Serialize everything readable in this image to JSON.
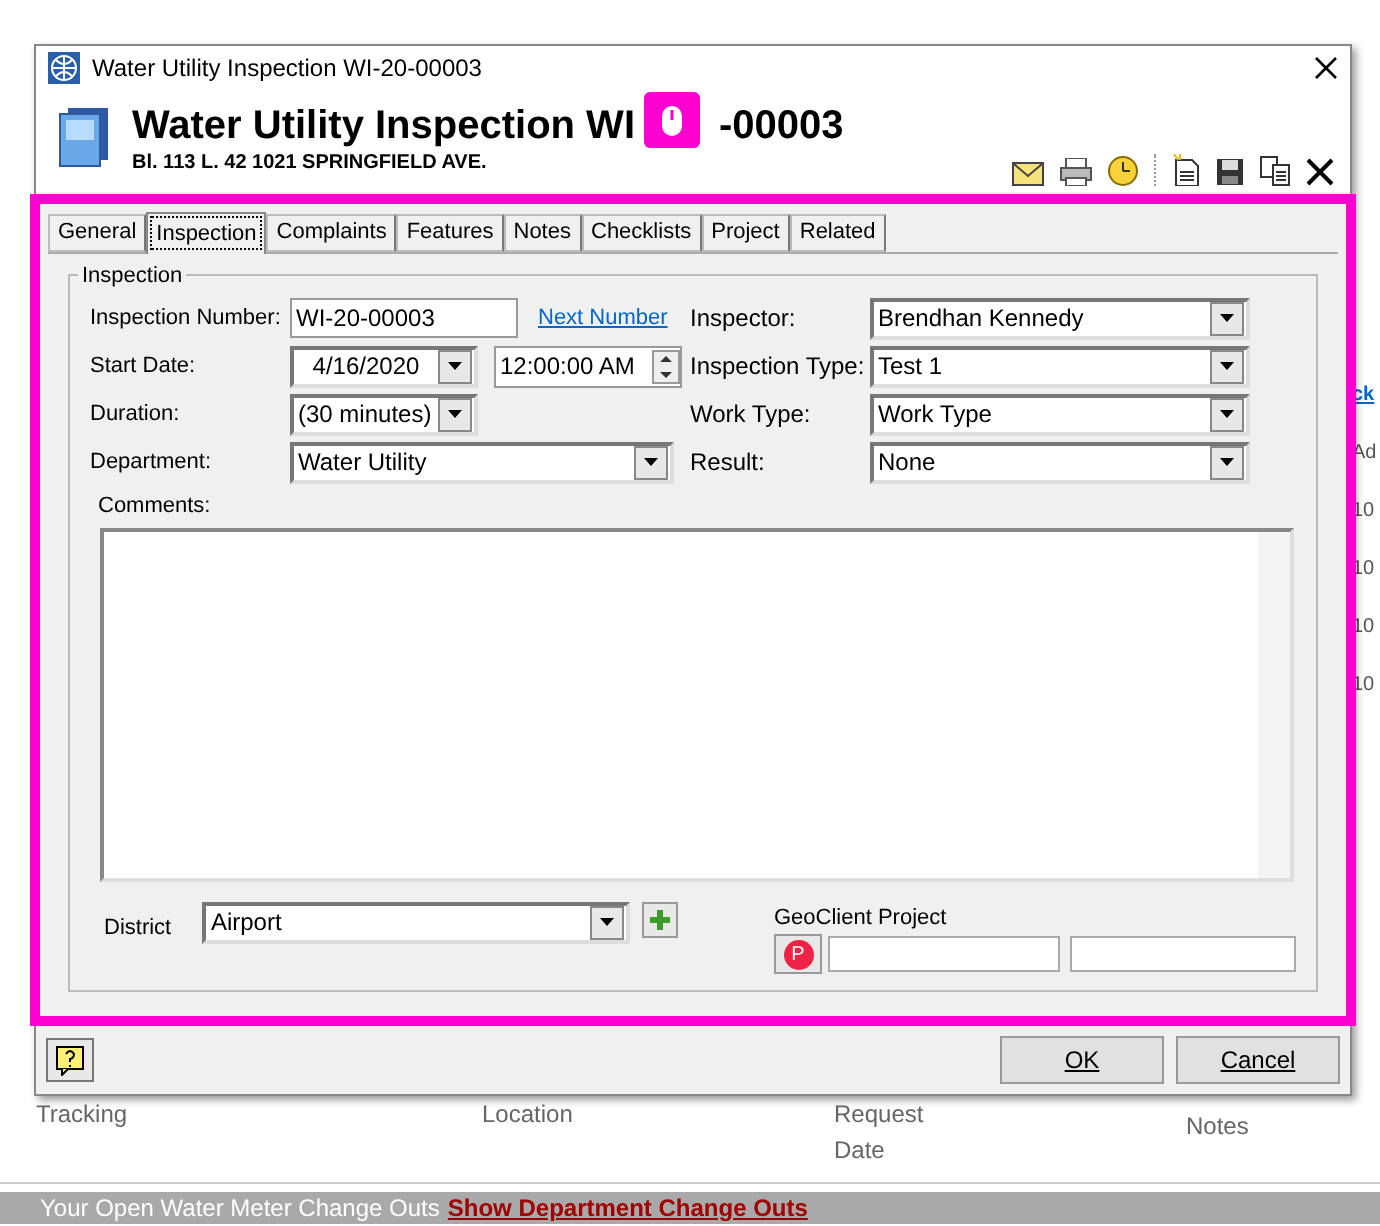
{
  "background": {
    "edge_texts": [
      {
        "text": "ck",
        "kind": "link"
      },
      {
        "text": "Ad",
        "kind": "plain"
      },
      {
        "text": "10",
        "kind": "plain"
      },
      {
        "text": "10",
        "kind": "plain"
      },
      {
        "text": "10",
        "kind": "plain"
      },
      {
        "text": "10",
        "kind": "plain"
      }
    ],
    "columns": [
      "Tracking",
      "Location",
      "Request Date",
      "Notes"
    ],
    "status": {
      "text": "Your Open Water Meter Change Outs",
      "link": "Show Department Change Outs"
    }
  },
  "dialog": {
    "title": "Water Utility Inspection WI-20-00003",
    "heading_start": "Water Utility Inspection WI",
    "heading_end": "-00003",
    "subheading": "Bl. 113 L. 42  1021 SPRINGFIELD AVE."
  },
  "tabs": [
    {
      "label": "General",
      "selected": false
    },
    {
      "label": "Inspection",
      "selected": true
    },
    {
      "label": "Complaints",
      "selected": false
    },
    {
      "label": "Features",
      "selected": false
    },
    {
      "label": "Notes",
      "selected": false
    },
    {
      "label": "Checklists",
      "selected": false
    },
    {
      "label": "Project",
      "selected": false
    },
    {
      "label": "Related",
      "selected": false
    }
  ],
  "group_title": "Inspection",
  "left_fields": [
    {
      "label": "Inspection Number:",
      "kind": "text",
      "value": "WI-20-00003",
      "link": "Next Number"
    },
    {
      "label": "Start Date:",
      "kind": "datetime",
      "value": "4/16/2020",
      "time": "12:00:00 AM"
    },
    {
      "label": "Duration:",
      "kind": "short_select",
      "value": "(30 minutes)"
    },
    {
      "label": "Department:",
      "kind": "select",
      "value": "Water Utility"
    }
  ],
  "right_fields": [
    {
      "label": "Inspector:",
      "value": "Brendhan Kennedy"
    },
    {
      "label": "Inspection Type:",
      "value": "Test 1"
    },
    {
      "label": "Work Type:",
      "value": "Work Type"
    },
    {
      "label": "Result:",
      "value": "None"
    }
  ],
  "comments_label": "Comments:",
  "district": {
    "label": "District",
    "value": "Airport"
  },
  "geoclient": {
    "label": "GeoClient Project",
    "button": "P"
  },
  "buttons": [
    "OK",
    "Cancel"
  ]
}
